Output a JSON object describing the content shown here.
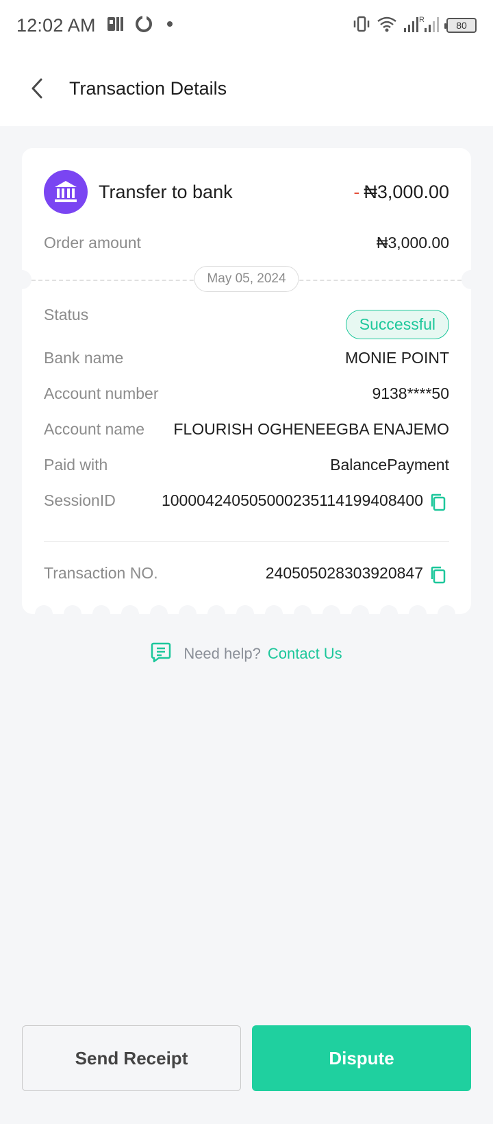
{
  "status_bar": {
    "time": "12:02 AM",
    "battery": "80",
    "icons": [
      "sim-icon",
      "sync-icon",
      "dot-icon",
      "vibrate-icon",
      "wifi-icon",
      "signal-icon"
    ]
  },
  "header": {
    "title": "Transaction Details"
  },
  "transaction": {
    "type": "Transfer to bank",
    "amount_sign": "-",
    "amount": "₦3,000.00",
    "order_amount_label": "Order amount",
    "order_amount": "₦3,000.00",
    "date": "May 05, 2024",
    "status_label": "Status",
    "status": "Successful",
    "details": [
      {
        "label": "Bank name",
        "value": "MONIE POINT"
      },
      {
        "label": "Account number",
        "value": "9138****50"
      },
      {
        "label": "Account name",
        "value": "FLOURISH OGHENEEGBA ENAJEMO"
      },
      {
        "label": "Paid with",
        "value": "BalancePayment"
      }
    ],
    "session_label": "SessionID",
    "session_id": "100004240505000235114199408400",
    "txno_label": "Transaction NO.",
    "txno": "240505028303920847"
  },
  "help": {
    "text": "Need help?",
    "link": "Contact Us"
  },
  "actions": {
    "send_receipt": "Send Receipt",
    "dispute": "Dispute"
  },
  "colors": {
    "accent": "#1fd09f",
    "bank_avatar": "#7a45f2",
    "negative": "#e5533d"
  }
}
